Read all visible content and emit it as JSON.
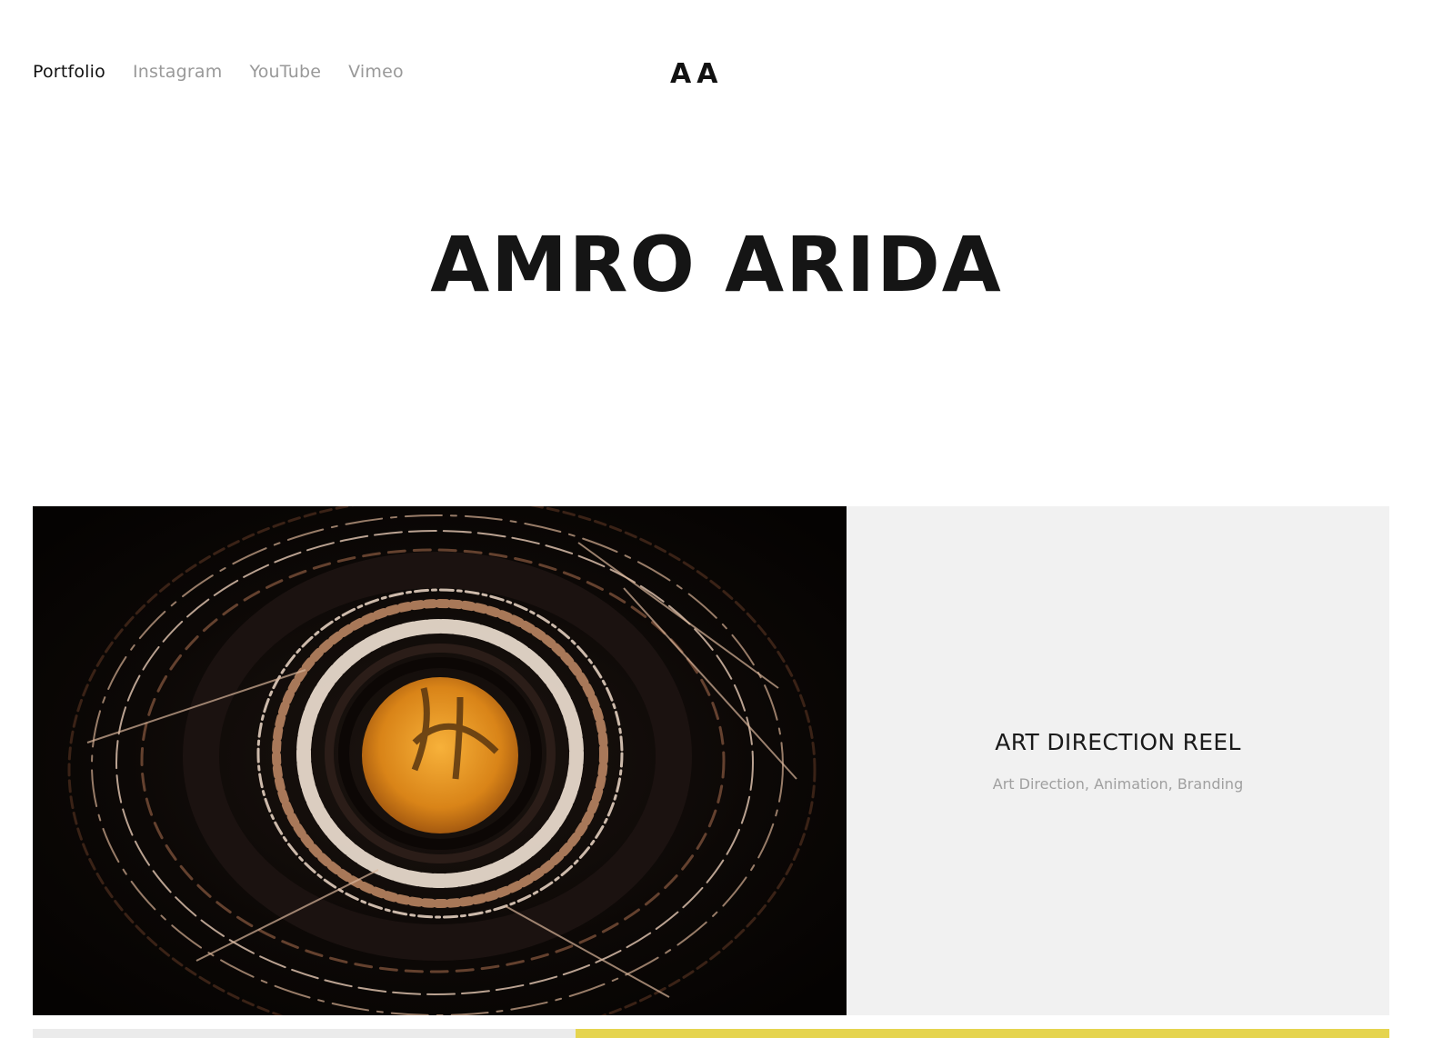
{
  "nav": {
    "items": [
      {
        "label": "Portfolio",
        "active": true
      },
      {
        "label": "Instagram",
        "active": false
      },
      {
        "label": "YouTube",
        "active": false
      },
      {
        "label": "Vimeo",
        "active": false
      }
    ]
  },
  "logo": {
    "text": "AA"
  },
  "hero": {
    "title": "AMRO ARIDA"
  },
  "projects": [
    {
      "title": "ART DIRECTION REEL",
      "tags": "Art Direction, Animation, Branding",
      "thumbnail_icon": "industrial-tower-image"
    }
  ],
  "colors": {
    "text_dark": "#151515",
    "nav_inactive": "#999999",
    "card_panel": "#f1f1f1",
    "next_accent": "#e5d44f"
  }
}
